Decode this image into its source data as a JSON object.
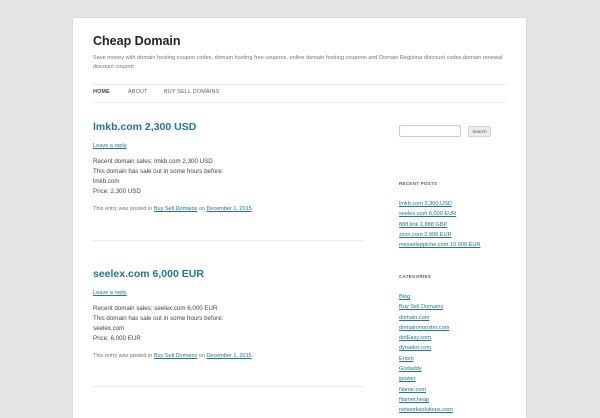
{
  "site": {
    "title": "Cheap Domain",
    "description": "Save money with domain hosting coupon codes, domain hosting free coupons, online domain hosting coupons and Domain Registrar discount codes,domain renewal discount coupon"
  },
  "nav": {
    "items": [
      "HOME",
      "ABOUT",
      "BUY SELL DOMAINS"
    ]
  },
  "posts": [
    {
      "title": "lmkb.com 2,300 USD",
      "reply": "Leave a reply",
      "lines": [
        "Recent domain sales: lmkb.com 2,300 USD",
        "This domain has sale out in some hours before:",
        "lmkb.com",
        "Price: 2,300 USD"
      ],
      "meta_prefix": "This entry was posted in",
      "category": "Buy Sell Domains",
      "meta_on": "on",
      "date": "December 1, 2015"
    },
    {
      "title": "seelex.com 6,000 EUR",
      "reply": "Leave a reply",
      "lines": [
        "Recent domain sales: seelex.com 6,000 EUR",
        "This domain has sale out in some hours before:",
        "seelex.com",
        "Price: 6,000 EUR"
      ],
      "meta_prefix": "This entry was posted in",
      "category": "Buy Sell Domains",
      "meta_on": "on",
      "date": "December 1, 2015"
    }
  ],
  "sidebar": {
    "search_button": "Search",
    "recent_posts_title": "RECENT POSTS",
    "recent_posts": [
      "lmkb.com 2,300 USD",
      "seelex.com 6,000 EUR",
      "888.link 1,888 GBP",
      "zzxn.com 2,900 EUR",
      "messeleppiche.com 10,000 EUR"
    ],
    "categories_title": "CATEGORIES",
    "categories": [
      "Blog",
      "Buy Sell Domains",
      "domain.com",
      "domainmonster.com",
      "dotEasy.com",
      "dynadot.com",
      "Enom",
      "Godaddy",
      "ipower",
      "Name.com",
      "Namecheap",
      "networksolutions.com"
    ]
  }
}
